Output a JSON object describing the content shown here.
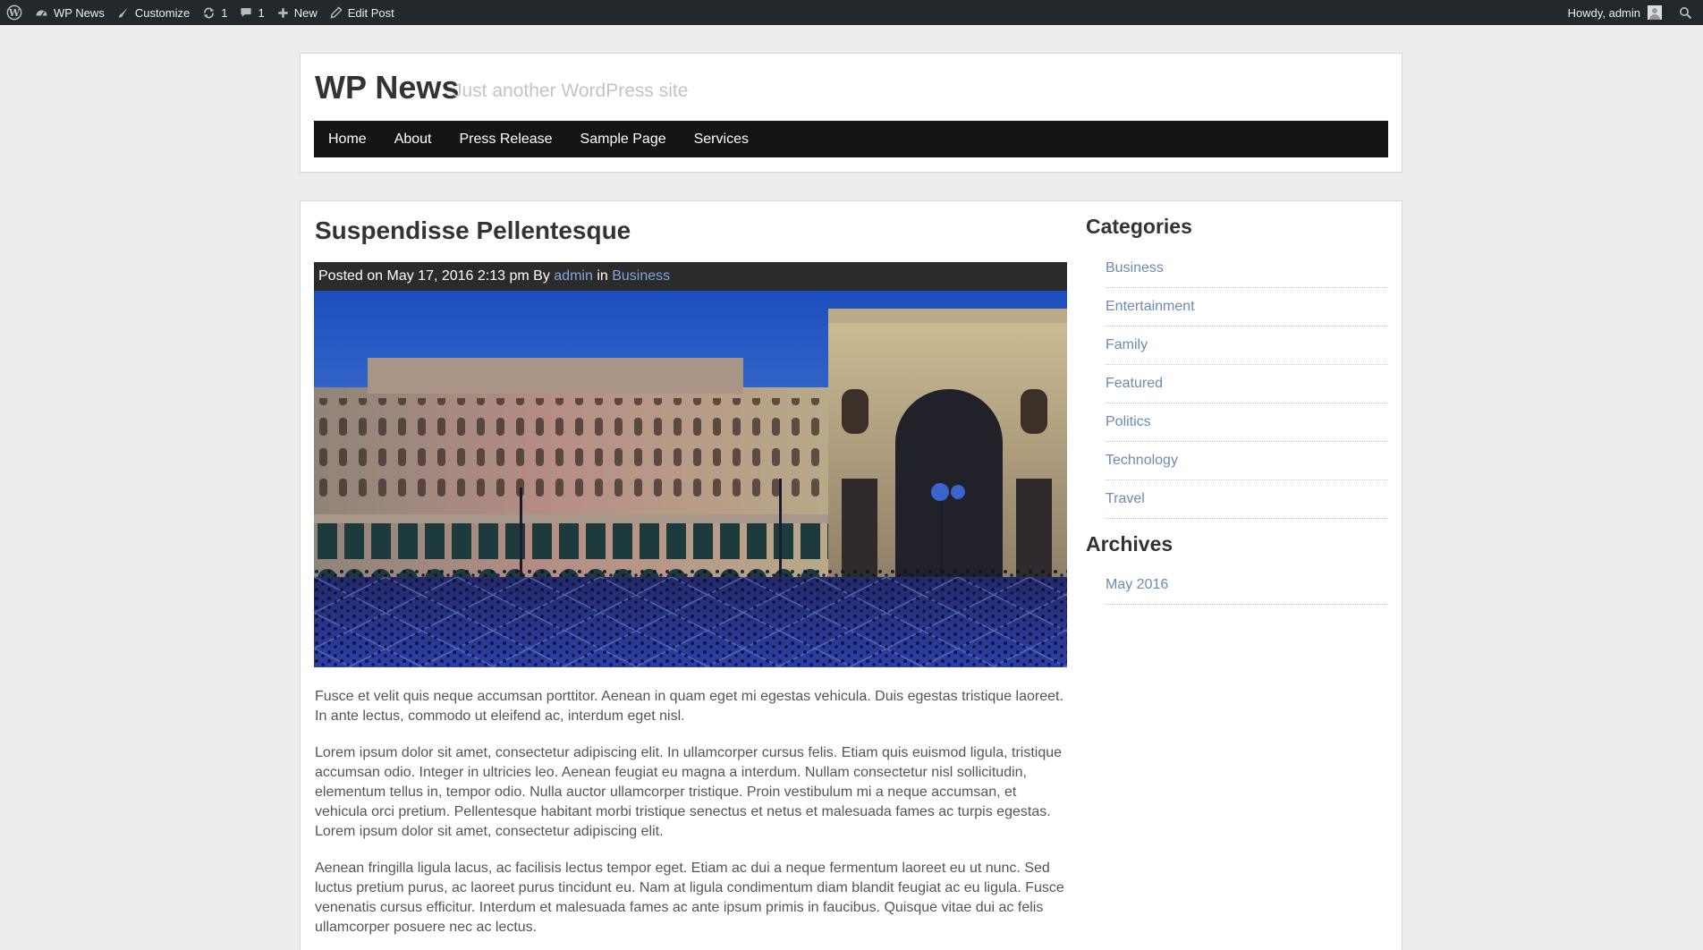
{
  "admin_bar": {
    "site_name": "WP News",
    "customize": "Customize",
    "updates_count": "1",
    "comments_count": "1",
    "new_label": "New",
    "edit_post": "Edit Post",
    "howdy": "Howdy, admin"
  },
  "header": {
    "title": "WP News",
    "description": "Just another WordPress site",
    "nav": [
      "Home",
      "About",
      "Press Release",
      "Sample Page",
      "Services"
    ]
  },
  "post": {
    "title": "Suspendisse Pellentesque",
    "meta": {
      "posted_on": "Posted on May 17, 2016 2:13 pm By",
      "author": "admin",
      "in": "in",
      "category": "Business"
    },
    "paragraphs": [
      "Fusce et velit quis neque accumsan porttitor. Aenean in quam eget mi egestas vehicula. Duis egestas tristique laoreet. In ante lectus, commodo ut eleifend ac, interdum eget nisl.",
      "Lorem ipsum dolor sit amet, consectetur adipiscing elit. In ullamcorper cursus felis. Etiam quis euismod ligula, tristique accumsan odio. Integer in ultricies leo. Aenean feugiat eu magna a interdum. Nullam consectetur nisl sollicitudin, elementum tellus in, tempor odio. Nulla auctor ullamcorper tristique. Proin vestibulum mi a neque accumsan, et vehicula orci pretium. Pellentesque habitant morbi tristique senectus et netus et malesuada fames ac turpis egestas. Lorem ipsum dolor sit amet, consectetur adipiscing elit.",
      "Aenean fringilla ligula lacus, ac facilisis lectus tempor eget. Etiam ac dui a neque fermentum laoreet eu ut nunc. Sed luctus pretium purus, ac laoreet purus tincidunt eu. Nam at ligula condimentum diam blandit feugiat ac eu ligula. Fusce venenatis cursus efficitur. Interdum et malesuada fames ac ante ipsum primis in faucibus. Quisque vitae dui ac felis ullamcorper posuere nec ac lectus."
    ]
  },
  "sidebar": {
    "categories_title": "Categories",
    "categories": [
      "Business",
      "Entertainment",
      "Family",
      "Featured",
      "Politics",
      "Technology",
      "Travel"
    ],
    "archives_title": "Archives",
    "archives": [
      "May 2016"
    ]
  },
  "colors": {
    "admin_bar_bg": "#23282d",
    "nav_bg": "#141414",
    "meta_bar_bg": "#2b2b2b",
    "link": "#6b8bb3"
  }
}
